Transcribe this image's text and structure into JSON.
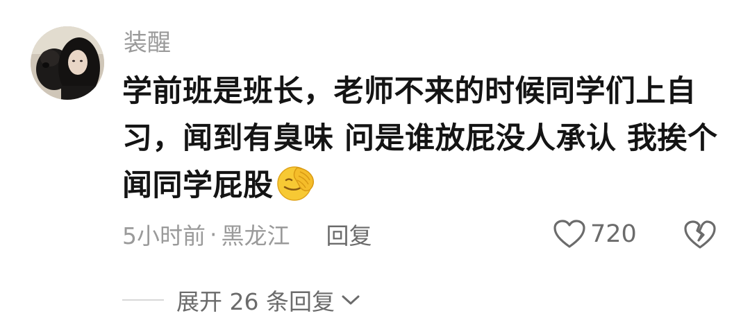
{
  "comment": {
    "username": "装醒",
    "text": "学前班是班长，老师不来的时候同学们上自习，闻到有臭味 问是谁放屁没人承认 我挨个闻同学屁股",
    "emoji": "face-palm-emoji",
    "time": "5小时前",
    "separator": "·",
    "location": "黑龙江",
    "reply_label": "回复",
    "likes": "720",
    "expand_label": "展开 26 条回复"
  },
  "icons": {
    "like": "heart-outline-icon",
    "dislike": "broken-heart-icon",
    "expand": "chevron-down-icon"
  },
  "colors": {
    "muted": "#9a9a9a",
    "secondary": "#6b6b6b",
    "text": "#141414"
  }
}
